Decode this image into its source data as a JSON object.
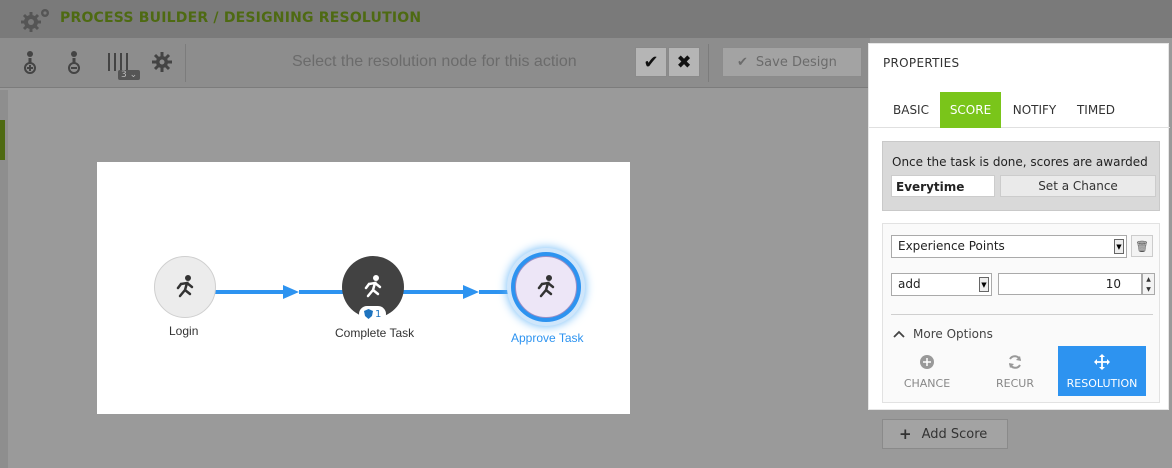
{
  "header": {
    "app_title": "PROCESS BUILDER",
    "separator": "/",
    "page": "DESIGNING RESOLUTION"
  },
  "toolbar": {
    "icons": [
      "add-node-icon",
      "remove-node-icon",
      "columns-icon",
      "settings-gear-icon"
    ],
    "zoom_badge": "3",
    "hint": "Select the resolution node for this action",
    "save_label": "Save Design"
  },
  "canvas": {
    "nodes": [
      {
        "label": "Login",
        "style": "light"
      },
      {
        "label": "Complete Task",
        "style": "dark",
        "badge": "1"
      },
      {
        "label": "Approve Task",
        "style": "selected"
      }
    ],
    "colors": {
      "arrow": "#2d93f0",
      "selected_label": "#2d93f0"
    }
  },
  "properties": {
    "title": "PROPERTIES",
    "tabs": [
      {
        "label": "BASIC",
        "active": false
      },
      {
        "label": "SCORE",
        "active": true
      },
      {
        "label": "NOTIFY",
        "active": false
      },
      {
        "label": "TIMED",
        "active": false
      }
    ],
    "score_text": "Once the task is done, scores are awarded",
    "frequency_value": "Everytime",
    "chance_label": "Set a Chance",
    "points_type": "Experience Points",
    "operation": "add",
    "amount": "10",
    "more_options_label": "More Options",
    "options": [
      {
        "label": "CHANCE",
        "icon": "chance-icon",
        "active": false
      },
      {
        "label": "RECUR",
        "icon": "recur-icon",
        "active": false
      },
      {
        "label": "RESOLUTION",
        "icon": "resolution-move-icon",
        "active": true
      }
    ],
    "accent": "#7ac51a"
  },
  "add_score_label": "Add Score"
}
